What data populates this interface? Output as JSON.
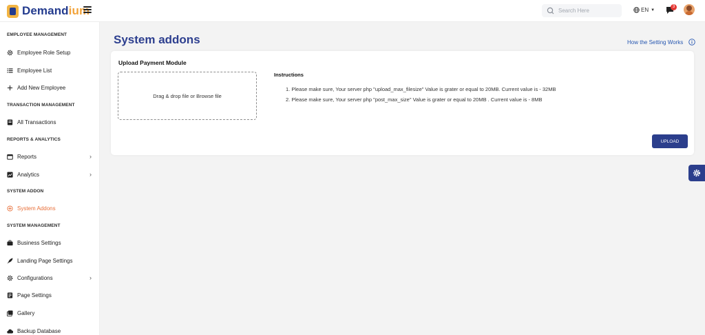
{
  "brand": {
    "name_part1": "Demand",
    "name_part2": "ium"
  },
  "header": {
    "search_placeholder": "Search Here",
    "language": "EN",
    "notification_count": "3"
  },
  "sidebar": {
    "sections": [
      {
        "title": "EMPLOYEE MANAGEMENT"
      },
      {
        "title": "TRANSACTION MANAGEMENT"
      },
      {
        "title": "REPORTS & ANALYTICS"
      },
      {
        "title": "SYSTEM ADDON"
      },
      {
        "title": "SYSTEM MANAGEMENT"
      }
    ],
    "items": [
      {
        "label": "Employee Role Setup",
        "icon": "gear-icon"
      },
      {
        "label": "Employee List",
        "icon": "list-icon"
      },
      {
        "label": "Add New Employee",
        "icon": "plus-icon"
      },
      {
        "label": "All Transactions",
        "icon": "receipt-icon"
      },
      {
        "label": "Reports",
        "icon": "calendar-icon",
        "has_children": true
      },
      {
        "label": "Analytics",
        "icon": "chart-icon",
        "has_children": true
      },
      {
        "label": "System Addons",
        "icon": "addon-icon",
        "active": true
      },
      {
        "label": "Business Settings",
        "icon": "briefcase-icon"
      },
      {
        "label": "Landing Page Settings",
        "icon": "rocket-icon"
      },
      {
        "label": "Configurations",
        "icon": "gear-icon",
        "has_children": true
      },
      {
        "label": "Page Settings",
        "icon": "page-icon"
      },
      {
        "label": "Gallery",
        "icon": "gallery-icon"
      },
      {
        "label": "Backup Database",
        "icon": "cloud-icon"
      }
    ]
  },
  "main": {
    "title": "System addons",
    "help_link": "How the Setting Works",
    "card": {
      "title": "Upload Payment Module",
      "dropzone_text": "Drag & drop file or Browse file",
      "instructions_title": "Instructions",
      "instructions": [
        "1. Please make sure, Your server php \"upload_max_filesize\" Value is grater or equal to 20MB. Current value is - 32MB",
        "2. Please make sure, Your server php \"post_max_size\" Value is grater or equal to 20MB . Current value is - 8MB"
      ],
      "upload_label": "UPLOAD"
    }
  },
  "colors": {
    "primary": "#2b3e8c",
    "accent": "#e8703a",
    "brand_orange": "#f2a33a",
    "link": "#2556b0"
  }
}
